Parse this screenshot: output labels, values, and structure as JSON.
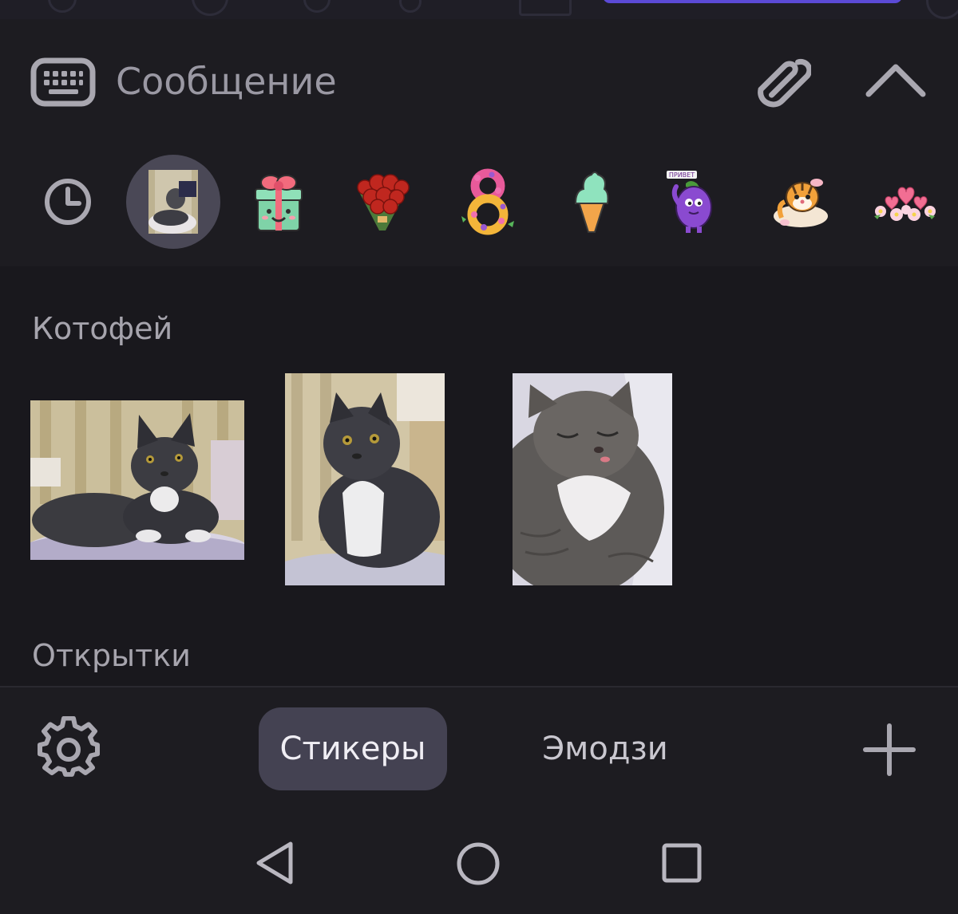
{
  "composer": {
    "placeholder": "Сообщение",
    "keyboard_icon": "keyboard-icon",
    "attach_icon": "paperclip-icon",
    "expand_icon": "chevron-up-icon"
  },
  "sticker_packs": [
    {
      "name": "recent",
      "icon": "clock-icon"
    },
    {
      "name": "kotofei",
      "icon": "cat-photo-thumbnail",
      "selected": true
    },
    {
      "name": "gift",
      "icon": "gift-box-sticker"
    },
    {
      "name": "roses",
      "icon": "rose-bouquet-sticker"
    },
    {
      "name": "march-8",
      "icon": "flower-eight-sticker"
    },
    {
      "name": "ice-cream",
      "icon": "ice-cream-sticker"
    },
    {
      "name": "eggplant",
      "icon": "eggplant-sticker"
    },
    {
      "name": "tiger",
      "icon": "tiger-sticker"
    },
    {
      "name": "flowers",
      "icon": "pink-flowers-sticker"
    }
  ],
  "sections": {
    "kotofei": {
      "title": "Котофей",
      "stickers": [
        "cat-lying-photo",
        "cat-sitting-photo",
        "cat-sleeping-photo"
      ]
    },
    "otkrytki": {
      "title": "Открытки"
    }
  },
  "bottom_bar": {
    "settings_icon": "gear-icon",
    "tabs": [
      {
        "label": "Стикеры",
        "active": true
      },
      {
        "label": "Эмодзи",
        "active": false
      }
    ],
    "add_icon": "plus-icon"
  },
  "navigation": {
    "back_icon": "back-triangle-icon",
    "home_icon": "home-circle-icon",
    "recents_icon": "recents-square-icon"
  },
  "colors": {
    "background": "#1d1c21",
    "panel": "#19181d",
    "selected_pill": "#444252",
    "text_primary": "#f0eef4",
    "text_secondary": "#a6a4ad"
  }
}
